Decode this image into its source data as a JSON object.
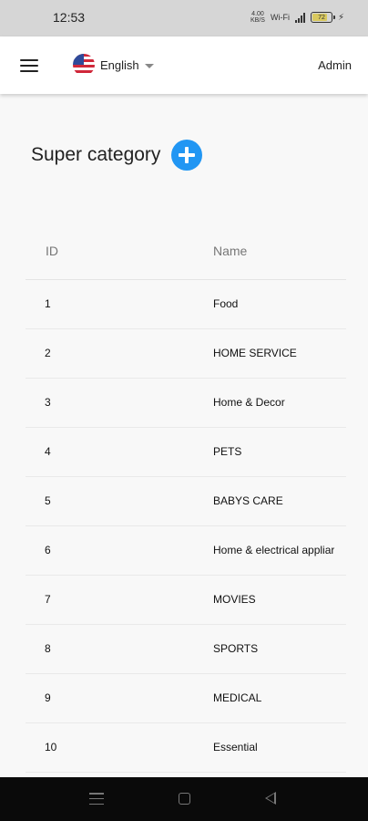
{
  "status_bar": {
    "time": "12:53",
    "net_speed_value": "4.00",
    "net_speed_unit": "KB/S",
    "wifi_label": "Wi-Fi",
    "battery_level": "72"
  },
  "app_bar": {
    "language": "English",
    "user": "Admin"
  },
  "page": {
    "title": "Super category"
  },
  "table": {
    "headers": {
      "id": "ID",
      "name": "Name"
    },
    "rows": [
      {
        "id": "1",
        "name": "Food"
      },
      {
        "id": "2",
        "name": "HOME SERVICE"
      },
      {
        "id": "3",
        "name": "Home & Decor"
      },
      {
        "id": "4",
        "name": "PETS"
      },
      {
        "id": "5",
        "name": "BABYS CARE"
      },
      {
        "id": "6",
        "name": "Home & electrical appliar"
      },
      {
        "id": "7",
        "name": "MOVIES"
      },
      {
        "id": "8",
        "name": "SPORTS"
      },
      {
        "id": "9",
        "name": "MEDICAL"
      },
      {
        "id": "10",
        "name": "Essential"
      }
    ]
  },
  "colors": {
    "accent": "#2196f3",
    "page_background": "#f8f8f8",
    "status_bar": "#d6d6d6",
    "nav_bar": "#0a0a0a"
  }
}
